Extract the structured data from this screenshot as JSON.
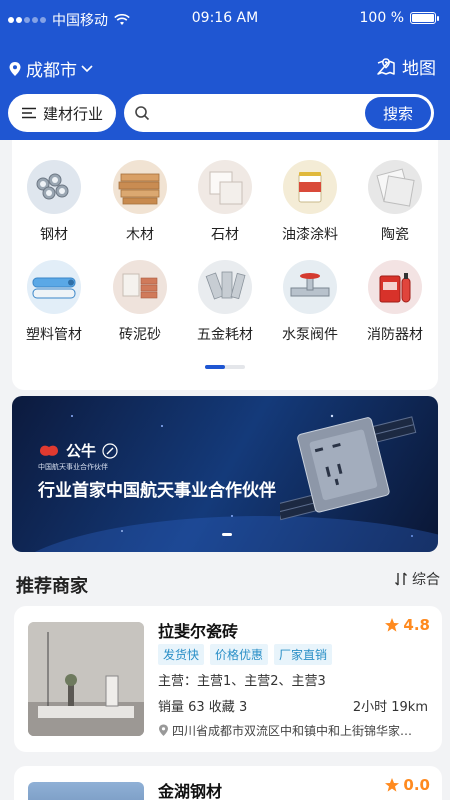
{
  "status_bar": {
    "carrier": "中国移动",
    "time": "09:16 AM",
    "battery": "100 %"
  },
  "location": {
    "city": "成都市",
    "map_label": "地图"
  },
  "search": {
    "industry_label": "建材行业",
    "placeholder": "",
    "button_label": "搜索"
  },
  "categories": [
    {
      "label": "钢材",
      "icon": "steel-pipes"
    },
    {
      "label": "木材",
      "icon": "wood-planks"
    },
    {
      "label": "石材",
      "icon": "stone-blocks"
    },
    {
      "label": "油漆涂料",
      "icon": "paint-bucket"
    },
    {
      "label": "陶瓷",
      "icon": "ceramic-tiles"
    },
    {
      "label": "塑料管材",
      "icon": "plastic-pipes"
    },
    {
      "label": "砖泥砂",
      "icon": "bricks-cement"
    },
    {
      "label": "五金耗材",
      "icon": "hardware-hinges"
    },
    {
      "label": "水泵阀件",
      "icon": "water-valve"
    },
    {
      "label": "消防器材",
      "icon": "fire-extinguisher"
    }
  ],
  "category_pager": {
    "current": 1,
    "total": 2
  },
  "banner": {
    "brand": "公牛",
    "brand_sub": "中国航天事业合作伙伴",
    "slogan": "行业首家中国航天事业合作伙伴",
    "current_slide": 1,
    "total_slides": 1
  },
  "section": {
    "title": "推荐商家",
    "sort_label": "综合"
  },
  "merchants": [
    {
      "name": "拉斐尔瓷砖",
      "rating": "4.8",
      "tags": [
        "发货快",
        "价格优惠",
        "厂家直销"
      ],
      "main_business": "主营：主营1、主营2、主营3",
      "stats": "销量 63  收藏 3",
      "distance": "2小时  19km",
      "address": "四川省成都市双流区中和镇中和上街锦华家…"
    },
    {
      "name": "金湖钢材",
      "rating": "0.0"
    }
  ],
  "colors": {
    "primary": "#1f56d2",
    "rating": "#ff8a1f",
    "tag_bg": "#e8f4fb",
    "tag_text": "#2a8fc7"
  }
}
